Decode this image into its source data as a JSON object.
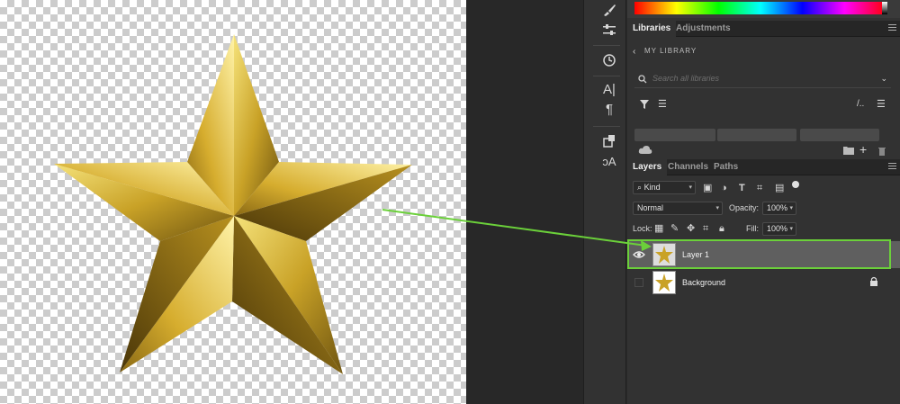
{
  "libraries_panel": {
    "tabs": [
      {
        "label": "Libraries",
        "active": true
      },
      {
        "label": "Adjustments",
        "active": false
      }
    ],
    "library_name": "MY LIBRARY",
    "search_placeholder": "Search all libraries"
  },
  "layers_panel": {
    "tabs": [
      {
        "label": "Layers",
        "active": true
      },
      {
        "label": "Channels",
        "active": false
      },
      {
        "label": "Paths",
        "active": false
      }
    ],
    "filter_kind": "Kind",
    "blend_mode": "Normal",
    "opacity_label": "Opacity:",
    "opacity_value": "100%",
    "lock_label": "Lock:",
    "fill_label": "Fill:",
    "fill_value": "100%",
    "layers": [
      {
        "name": "Layer 1",
        "visible": true,
        "selected": true,
        "locked": false
      },
      {
        "name": "Background",
        "visible": false,
        "selected": false,
        "locked": true
      }
    ]
  },
  "colors": {
    "highlight": "#6bd03a",
    "panel_bg": "#323232",
    "selected_row": "#5f5f5f",
    "star_gold": "#c9a227"
  },
  "icons": [
    "brush-icon",
    "adjust-sliders-icon",
    "history-icon",
    "character-icon",
    "paragraph-icon",
    "properties-icon",
    "glyphs-icon",
    "search-icon",
    "filter-icon",
    "sort-icon",
    "list-view-icon",
    "cloud-sync-icon",
    "folder-icon",
    "plus-icon",
    "trash-icon",
    "eye-icon",
    "lock-icon"
  ]
}
